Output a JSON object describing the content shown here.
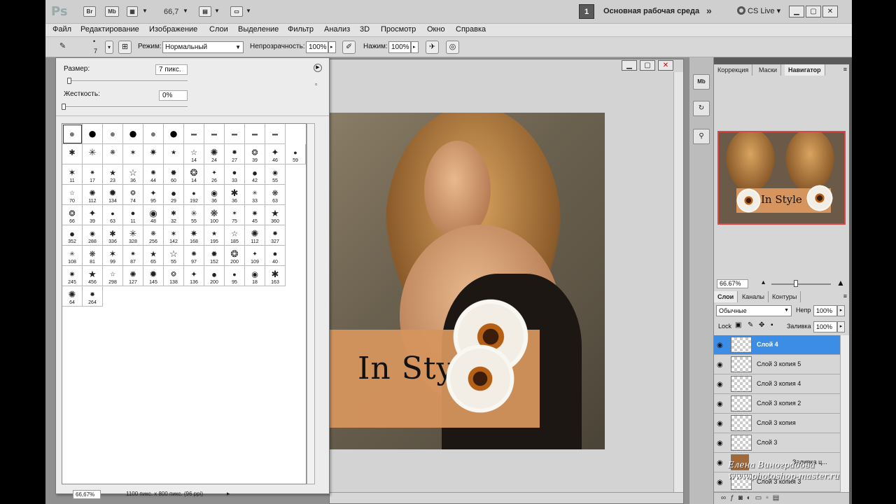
{
  "app": {
    "logo": "Ps",
    "zoom": "66,7"
  },
  "titlebar": {
    "icons": [
      {
        "label": "Br"
      },
      {
        "label": "Mb"
      }
    ],
    "workspace_number": "1",
    "workspace_name": "Основная рабочая среда",
    "more": "»",
    "cs_live": "CS Live",
    "cs_live_arrow": "▾",
    "window_buttons": [
      "▁",
      "▢",
      "✕"
    ]
  },
  "menu": [
    "Файл",
    "Редактирование",
    "Изображение",
    "Слои",
    "Выделение",
    "Фильтр",
    "Анализ",
    "3D",
    "Просмотр",
    "Окно",
    "Справка"
  ],
  "options": {
    "brush_size": "7",
    "mode_label": "Режим:",
    "mode_value": "Нормальный",
    "opacity_label": "Непрозрачность:",
    "opacity_value": "100%",
    "pressure_label": "Нажим:",
    "pressure_value": "100%"
  },
  "brush_picker": {
    "size_label": "Размер:",
    "size_value": "7 пикс.",
    "size_level": 0.02,
    "hardness_label": "Жесткость:",
    "hardness_value": "0%",
    "hardness_level": 0.0,
    "rows": [
      [
        "",
        "",
        "",
        "",
        "",
        "",
        "",
        "",
        "",
        "",
        ""
      ],
      [
        "",
        "",
        "",
        "",
        "",
        "",
        "14",
        "24",
        "27",
        "39",
        "46",
        "59"
      ],
      [
        "11",
        "17",
        "23",
        "36",
        "44",
        "60",
        "14",
        "26",
        "33",
        "42",
        "55"
      ],
      [
        "70",
        "112",
        "134",
        "74",
        "95",
        "29",
        "192",
        "36",
        "36",
        "33",
        "63"
      ],
      [
        "66",
        "39",
        "63",
        "11",
        "48",
        "32",
        "55",
        "100",
        "75",
        "45",
        "360"
      ],
      [
        "352",
        "288",
        "336",
        "328",
        "256",
        "142",
        "168",
        "195",
        "185",
        "112",
        "327"
      ],
      [
        "108",
        "81",
        "99",
        "87",
        "65",
        "55",
        "97",
        "152",
        "200",
        "109",
        "40"
      ],
      [
        "245",
        "456",
        "298",
        "127",
        "145",
        "138",
        "136",
        "200",
        "95",
        "18",
        "163"
      ],
      [
        "64",
        "264"
      ]
    ]
  },
  "document": {
    "window_buttons": [
      "▁",
      "▢",
      "✕"
    ],
    "canvas_text": "In Style",
    "status_zoom": "66,67%",
    "status_info": "1100 пикс. x 800 пикс. (96 ppi)",
    "status_arrow": "▸"
  },
  "dock": {
    "tool_icons": [
      "Mb",
      "↻",
      "⚲"
    ],
    "nav_tabs": [
      "Коррекция",
      "Маски",
      "Навигатор"
    ],
    "nav_zoom": "66.67%",
    "nav_thumb_text": "In Style",
    "layer_tabs": [
      "Слои",
      "Каналы",
      "Контуры"
    ],
    "blend_mode": "Обычные",
    "opacity_label": "Непр",
    "opacity_value": "100%",
    "lock_label": "Lock",
    "fill_label": "Заливка",
    "fill_value": "100%",
    "layers": [
      {
        "name": "Слой 4",
        "selected": true
      },
      {
        "name": "Слой 3 копия 5",
        "selected": false
      },
      {
        "name": "Слой 3 копия 4",
        "selected": false
      },
      {
        "name": "Слой 3 копия 2",
        "selected": false
      },
      {
        "name": "Слой 3 копия",
        "selected": false
      },
      {
        "name": "Слой 3",
        "selected": false
      },
      {
        "name": "Заливка ц...",
        "selected": false
      },
      {
        "name": "Слой 3 копия 3",
        "selected": false
      }
    ]
  },
  "watermark": {
    "line1": "Елена Виноградова",
    "line2": "www.photoshop-master.ru"
  }
}
